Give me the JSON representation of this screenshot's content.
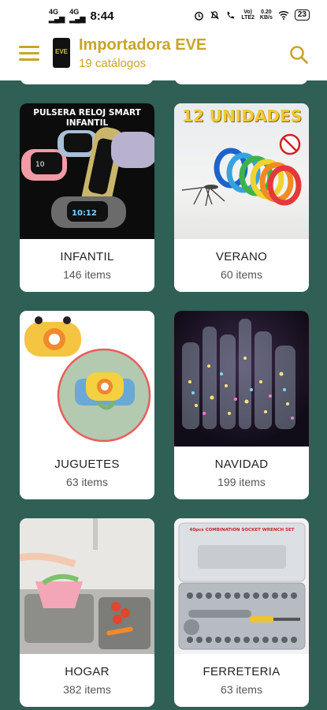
{
  "status_bar": {
    "network_left": "4G",
    "network_left2": "4G",
    "time": "8:44",
    "volte": "Vo)",
    "lte": "LTE2",
    "speed": "0.20",
    "speed_unit": "KB/s",
    "battery": "23"
  },
  "app": {
    "title": "Importadora EVE",
    "subtitle": "19 catálogos",
    "logo_text": "EVE"
  },
  "catalogs": [
    {
      "name": "INFANTIL",
      "count": "146 items",
      "image_text": "PULSERA RELOJ SMART INFANTIL"
    },
    {
      "name": "VERANO",
      "count": "60 items",
      "image_text": "12 UNIDADES"
    },
    {
      "name": "JUGUETES",
      "count": "63 items"
    },
    {
      "name": "NAVIDAD",
      "count": "199 items"
    },
    {
      "name": "HOGAR",
      "count": "382 items"
    },
    {
      "name": "FERRETERIA",
      "count": "63 items",
      "image_text": "40pcs COMBINATION SOCKET WRENCH SET"
    }
  ],
  "colors": {
    "background": "#2f5f55",
    "accent": "#c8a52a"
  },
  "icons": [
    "menu-icon",
    "search-icon",
    "alarm-icon",
    "mute-icon",
    "call-icon",
    "wifi-icon",
    "battery-icon"
  ]
}
